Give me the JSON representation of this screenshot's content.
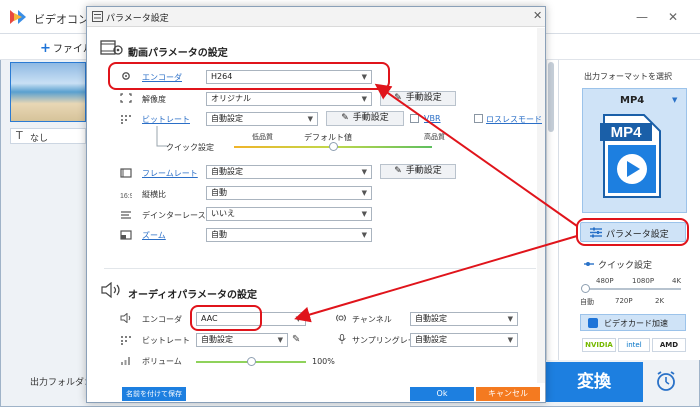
{
  "app": {
    "title": "ビデオコン",
    "add_file": "ファイル",
    "subtitle_value": "なし",
    "output_folder_label": "出力フォルダ：",
    "select_output_format": "出力フォーマットを選択",
    "format_name": "MP4",
    "format_icon_text": "MP4",
    "param_button": "パラメータ設定",
    "quick_settings": "クイック設定",
    "quick_ticks_top": [
      "480P",
      "1080P",
      "4K"
    ],
    "quick_ticks_bottom": [
      "自動",
      "720P",
      "2K"
    ],
    "gpu_accel": "ビデオカード加速",
    "vendors": [
      "NVIDIA",
      "intel",
      "AMD"
    ],
    "convert": "変換"
  },
  "dialog": {
    "title": "パラメータ設定",
    "video_section": "動画パラメータの設定",
    "video": {
      "encoder_label": "エンコーダ",
      "encoder_value": "H264",
      "resolution_label": "解像度",
      "resolution_value": "オリジナル",
      "resolution_manual": "手動設定",
      "bitrate_label": "ビットレート",
      "bitrate_value": "自動設定",
      "bitrate_manual": "手動設定",
      "vbr_label": "VBR",
      "lossless_label": "ロスレスモード",
      "quick_label": "クイック設定",
      "quality_low": "低品質",
      "quality_default": "デフォルト値",
      "quality_high": "高品質",
      "quality_level": 0.5,
      "framerate_label": "フレームレート",
      "framerate_value": "自動設定",
      "framerate_manual": "手動設定",
      "aspect_label": "縦横比",
      "aspect_value": "自動",
      "deinterlace_label": "デインターレース",
      "deinterlace_value": "いいえ",
      "zoom_label": "ズーム",
      "zoom_value": "自動"
    },
    "audio_section": "オーディオパラメータの設定",
    "audio": {
      "encoder_label": "エンコーダ",
      "encoder_value": "AAC",
      "channel_label": "チャンネル",
      "channel_value": "自動設定",
      "bitrate_label": "ビットレート",
      "bitrate_value": "自動設定",
      "samplerate_label": "サンプリングレート",
      "samplerate_value": "自動設定",
      "volume_label": "ボリューム",
      "volume_value": "100%",
      "volume_level": 0.5
    },
    "save_named": "名前を付けて保存",
    "ok": "Ok",
    "cancel": "キャンセル"
  },
  "colors": {
    "accent": "#1d7fe0",
    "highlight": "#e0141b",
    "cancel": "#f47a20"
  }
}
